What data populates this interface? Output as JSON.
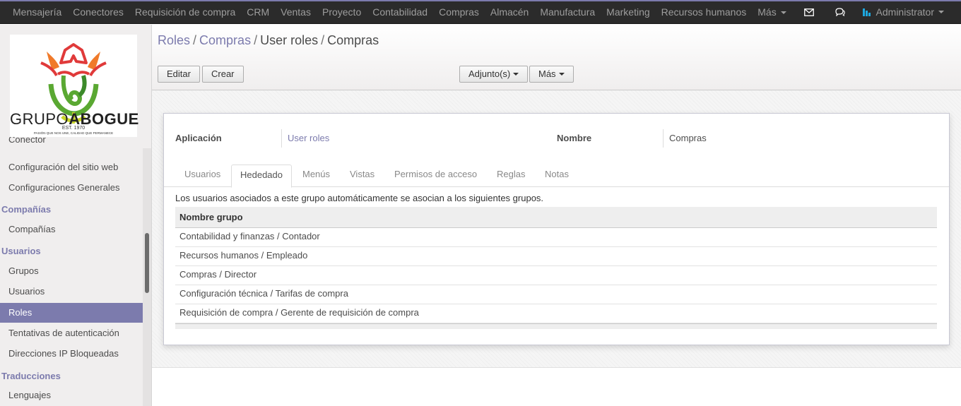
{
  "topbar": {
    "menu": [
      {
        "label": "Mensajería"
      },
      {
        "label": "Conectores"
      },
      {
        "label": "Requisición de compra"
      },
      {
        "label": "CRM"
      },
      {
        "label": "Ventas"
      },
      {
        "label": "Proyecto"
      },
      {
        "label": "Contabilidad"
      },
      {
        "label": "Compras"
      },
      {
        "label": "Almacén"
      },
      {
        "label": "Manufactura"
      },
      {
        "label": "Marketing"
      },
      {
        "label": "Recursos humanos"
      },
      {
        "label": "Más"
      }
    ],
    "user": "Administrator",
    "icons": [
      "envelope-icon",
      "chat-icon"
    ]
  },
  "logo": {
    "text_left": "GRUPO",
    "text_right": "ABOGUE",
    "est": "EST. 1970",
    "slogan": "PASIÓN QUE NOS UNE, CALIDAD QUE PERMANECE"
  },
  "sidebar": {
    "partial_item": "Conector",
    "items": [
      {
        "label": "Configuración del sitio web"
      },
      {
        "label": "Configuraciones Generales"
      }
    ],
    "sections": [
      {
        "title": "Compañías",
        "items": [
          {
            "label": "Compañías"
          }
        ]
      },
      {
        "title": "Usuarios",
        "items": [
          {
            "label": "Grupos"
          },
          {
            "label": "Usuarios"
          },
          {
            "label": "Roles"
          },
          {
            "label": "Tentativas de autenticación"
          },
          {
            "label": "Direcciones IP Bloqueadas"
          }
        ]
      },
      {
        "title": "Traducciones",
        "items": [
          {
            "label": "Lenguajes"
          }
        ]
      }
    ],
    "active": "Roles"
  },
  "breadcrumb": {
    "items": [
      "Roles",
      "Compras",
      "User roles",
      "Compras"
    ],
    "separator": "/"
  },
  "buttons": {
    "edit": "Editar",
    "create": "Crear",
    "attachments": "Adjunto(s)",
    "more": "Más"
  },
  "form": {
    "application_label": "Aplicación",
    "application_value": "User roles",
    "name_label": "Nombre",
    "name_value": "Compras"
  },
  "tabs": [
    {
      "label": "Usuarios"
    },
    {
      "label": "Hededado"
    },
    {
      "label": "Menús"
    },
    {
      "label": "Vistas"
    },
    {
      "label": "Permisos de acceso"
    },
    {
      "label": "Reglas"
    },
    {
      "label": "Notas"
    }
  ],
  "active_tab": "Hededado",
  "inherited": {
    "description": "Los usuarios asociados a este grupo automáticamente se asocian a los siguientes grupos.",
    "column_header": "Nombre grupo",
    "rows": [
      "Contabilidad y finanzas / Contador",
      "Recursos humanos / Empleado",
      "Compras / Director",
      "Configuración técnica / Tarifas de compra",
      "Requisición de compra / Gerente de requisición de compra"
    ]
  },
  "colors": {
    "brand": "#7c7bad",
    "navbar": "#2b2b2b",
    "sidebar_bg": "#f0eeee"
  }
}
